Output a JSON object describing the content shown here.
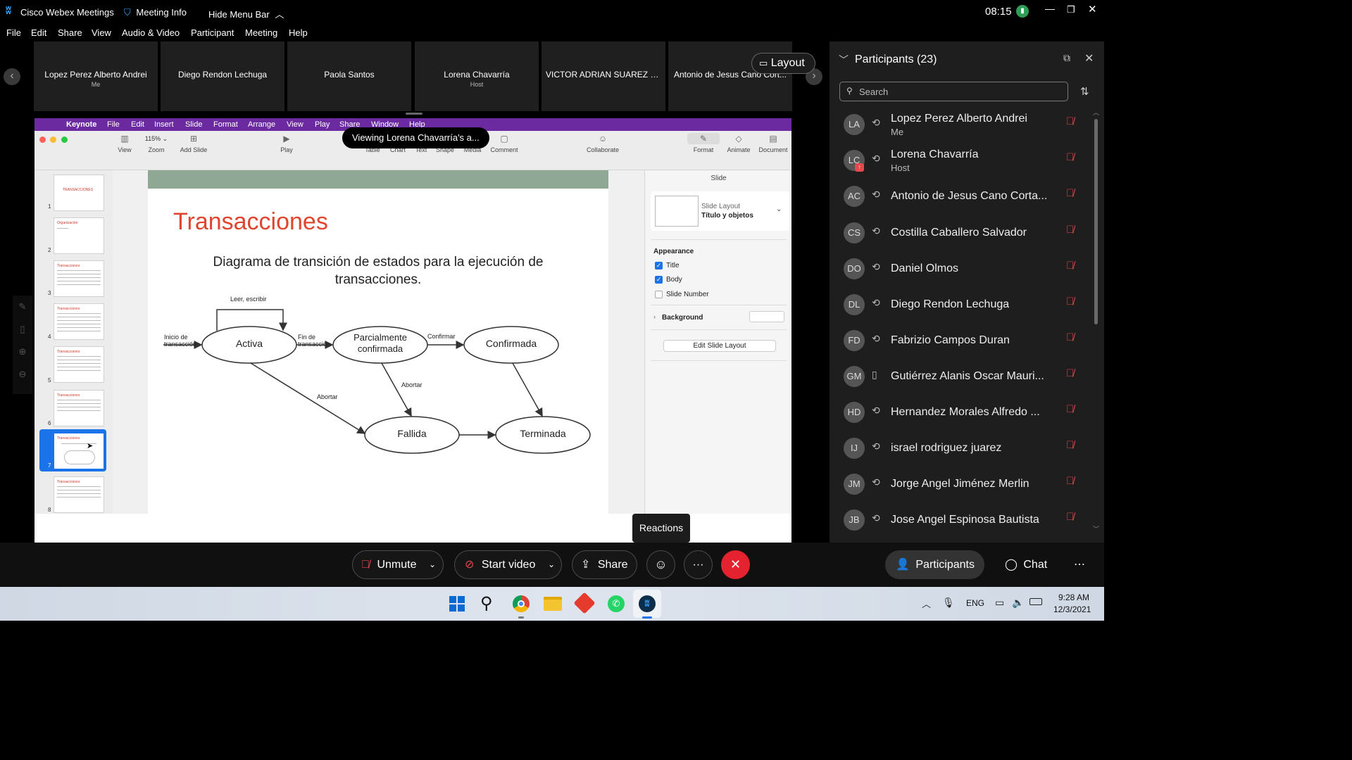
{
  "titlebar": {
    "app_title": "Cisco Webex Meetings",
    "meeting_info": "Meeting Info",
    "hide_menu": "Hide Menu Bar",
    "clock": "08:15"
  },
  "menu": [
    "File",
    "Edit",
    "Share",
    "View",
    "Audio & Video",
    "Participant",
    "Meeting",
    "Help"
  ],
  "tiles": [
    {
      "name": "Lopez Perez Alberto Andrei",
      "role": "Me"
    },
    {
      "name": "Diego Rendon Lechuga",
      "role": ""
    },
    {
      "name": "Paola Santos",
      "role": ""
    },
    {
      "name": "Lorena Chavarría",
      "role": "Host"
    },
    {
      "name": "VICTOR ADRIAN SUAREZ O...",
      "role": ""
    },
    {
      "name": "Antonio de Jesus Cano Cort...",
      "role": ""
    }
  ],
  "layout_label": "Layout",
  "viewing_tooltip": "Viewing Lorena Chavarría's a...",
  "keynote": {
    "menu": [
      "Keynote",
      "File",
      "Edit",
      "Insert",
      "Slide",
      "Format",
      "Arrange",
      "View",
      "Play",
      "Share",
      "Window",
      "Help"
    ],
    "toolbar": {
      "view": "View",
      "zoom_value": "115%",
      "zoom": "Zoom",
      "add_slide": "Add Slide",
      "play": "Play",
      "table": "Table",
      "chart": "Chart",
      "text": "Text",
      "shape": "Shape",
      "media": "Media",
      "comment": "Comment",
      "collaborate": "Collaborate",
      "format": "Format",
      "animate": "Animate",
      "document": "Document"
    },
    "thumb_numbers": [
      "1",
      "2",
      "3",
      "4",
      "5",
      "6",
      "7",
      "8"
    ],
    "thumb_titles": [
      "TRANSACCIONES",
      "Organización",
      "Transacciones",
      "Transacciones",
      "Transacciones",
      "Transacciones",
      "Transacciones",
      "Transacciones"
    ],
    "slide": {
      "title": "Transacciones",
      "subtitle": "Diagrama de transición de estados para la ejecución de transacciones.",
      "states": {
        "activa": "Activa",
        "parcial": "Parcialmente confirmada",
        "confirmada": "Confirmada",
        "fallida": "Fallida",
        "terminada": "Terminada"
      },
      "labels": {
        "leer": "Leer, escribir",
        "inicio": "Inicio de transacción",
        "fin": "Fin de transacción",
        "confirmar": "Confirmar",
        "abortar1": "Abortar",
        "abortar2": "Abortar"
      }
    },
    "panel": {
      "tab": "Slide",
      "layout_label": "Slide Layout",
      "layout_name": "Título y objetos",
      "appearance": "Appearance",
      "title": "Title",
      "body": "Body",
      "slide_number": "Slide Number",
      "background": "Background",
      "edit_layout": "Edit Slide Layout"
    }
  },
  "reactions": "Reactions",
  "participants_panel": {
    "title": "Participants (23)",
    "search_placeholder": "Search",
    "list": [
      {
        "initials": "LA",
        "name": "Lopez Perez Alberto Andrei",
        "role": "Me"
      },
      {
        "initials": "LC",
        "name": "Lorena Chavarría",
        "role": "Host"
      },
      {
        "initials": "AC",
        "name": "Antonio de Jesus Cano Corta...",
        "role": ""
      },
      {
        "initials": "CS",
        "name": "Costilla Caballero Salvador",
        "role": ""
      },
      {
        "initials": "DO",
        "name": "Daniel Olmos",
        "role": ""
      },
      {
        "initials": "DL",
        "name": "Diego Rendon Lechuga",
        "role": ""
      },
      {
        "initials": "FD",
        "name": "Fabrizio Campos Duran",
        "role": ""
      },
      {
        "initials": "GM",
        "name": "Gutiérrez Alanis Oscar Mauri...",
        "role": ""
      },
      {
        "initials": "HD",
        "name": "Hernandez Morales Alfredo ...",
        "role": ""
      },
      {
        "initials": "IJ",
        "name": "israel rodriguez juarez",
        "role": ""
      },
      {
        "initials": "JM",
        "name": "Jorge Angel Jiménez Merlin",
        "role": ""
      },
      {
        "initials": "JB",
        "name": "Jose Angel Espinosa Bautista",
        "role": ""
      }
    ]
  },
  "controls": {
    "unmute": "Unmute",
    "start_video": "Start video",
    "share": "Share",
    "participants": "Participants",
    "chat": "Chat"
  },
  "taskbar": {
    "lang": "ENG",
    "time": "9:28 AM",
    "date": "12/3/2021"
  },
  "colors": {
    "keynote_menu": "#6c2aa0",
    "slide_title": "#e0452f",
    "end_call": "#e5222f",
    "accent_blue": "#1a73e8"
  }
}
